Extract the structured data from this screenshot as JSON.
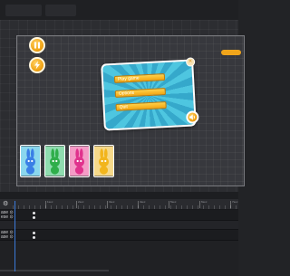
{
  "dialog": {
    "buttons": [
      {
        "label": "Play game"
      },
      {
        "label": "Options"
      },
      {
        "label": "Quit"
      }
    ],
    "close_glyph": "×"
  },
  "icons": {
    "pause": "pause-icon",
    "lightning": "lightning-icon",
    "close": "close-icon",
    "sound": "speaker-icon",
    "settings": "gear-icon"
  },
  "cards": [
    {
      "color": "#3a7fe6",
      "bg": "#8ad7ee"
    },
    {
      "color": "#2fae4a",
      "bg": "#8fdcaf"
    },
    {
      "color": "#e0328d",
      "bg": "#f49bc6"
    },
    {
      "color": "#f2b51c",
      "bg": "#f6d98a"
    }
  ],
  "timeline": {
    "gear_glyph": "⚙",
    "ruler_labels": [
      "1sec",
      "2sec",
      "3sec",
      "4sec",
      "5sec",
      "6sec",
      "7sec"
    ],
    "tracks": [
      {
        "line1": "ase ⊙",
        "line2": "ese ⊙"
      },
      {
        "line1": "ase ⊙",
        "line2": "ase ⊙"
      }
    ]
  },
  "colors": {
    "accent_orange": "#f2a516",
    "playhead_blue": "#3b79d8"
  }
}
